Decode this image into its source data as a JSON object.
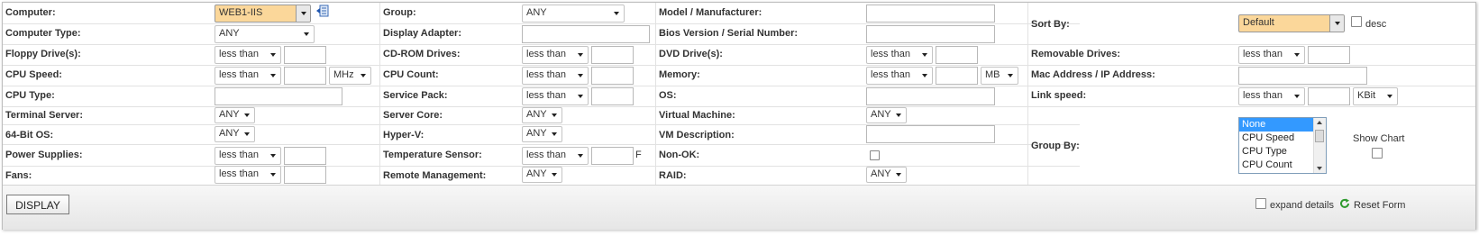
{
  "fields": {
    "computer": {
      "label": "Computer:",
      "value": "WEB1-IIS"
    },
    "group": {
      "label": "Group:",
      "value": "ANY"
    },
    "model": {
      "label": "Model / Manufacturer:"
    },
    "computer_type": {
      "label": "Computer Type:",
      "value": "ANY"
    },
    "display_adapter": {
      "label": "Display Adapter:"
    },
    "bios": {
      "label": "Bios Version / Serial Number:"
    },
    "floppy": {
      "label": "Floppy Drive(s):",
      "op": "less than"
    },
    "cdrom": {
      "label": "CD-ROM Drives:",
      "op": "less than"
    },
    "dvd": {
      "label": "DVD Drive(s):",
      "op": "less than"
    },
    "cpu_speed": {
      "label": "CPU Speed:",
      "op": "less than",
      "unit": "MHz"
    },
    "cpu_count": {
      "label": "CPU Count:",
      "op": "less than"
    },
    "memory": {
      "label": "Memory:",
      "op": "less than",
      "unit": "MB"
    },
    "cpu_type": {
      "label": "CPU Type:"
    },
    "service_pack": {
      "label": "Service Pack:",
      "op": "less than"
    },
    "os": {
      "label": "OS:"
    },
    "terminal_server": {
      "label": "Terminal Server:",
      "value": "ANY"
    },
    "server_core": {
      "label": "Server Core:",
      "value": "ANY"
    },
    "virtual_machine": {
      "label": "Virtual Machine:",
      "value": "ANY"
    },
    "bit64": {
      "label": "64-Bit OS:",
      "value": "ANY"
    },
    "hyperv": {
      "label": "Hyper-V:",
      "value": "ANY"
    },
    "vm_description": {
      "label": "VM Description:"
    },
    "power_supplies": {
      "label": "Power Supplies:",
      "op": "less than"
    },
    "temperature": {
      "label": "Temperature Sensor:",
      "op": "less than",
      "unit": "F"
    },
    "non_ok": {
      "label": "Non-OK:"
    },
    "fans": {
      "label": "Fans:",
      "op": "less than"
    },
    "remote_mgmt": {
      "label": "Remote Management:",
      "value": "ANY"
    },
    "raid": {
      "label": "RAID:",
      "value": "ANY"
    }
  },
  "right": {
    "sort_by": {
      "label": "Sort By:",
      "value": "Default",
      "desc_label": "desc"
    },
    "removable": {
      "label": "Removable Drives:",
      "op": "less than"
    },
    "mac": {
      "label": "Mac Address / IP Address:"
    },
    "link_speed": {
      "label": "Link speed:",
      "op": "less than",
      "unit": "KBit"
    },
    "group_by": {
      "label": "Group By:",
      "options": [
        "None",
        "CPU Speed",
        "CPU Type",
        "CPU Count"
      ]
    },
    "show_chart": {
      "label": "Show Chart"
    }
  },
  "footer": {
    "display_label": "DISPLAY",
    "expand_label": "expand details",
    "reset_label": "Reset Form"
  },
  "colors": {
    "highlight": "#fbd79a",
    "selection": "#3399ff",
    "reset_icon": "#2e9a2e"
  }
}
